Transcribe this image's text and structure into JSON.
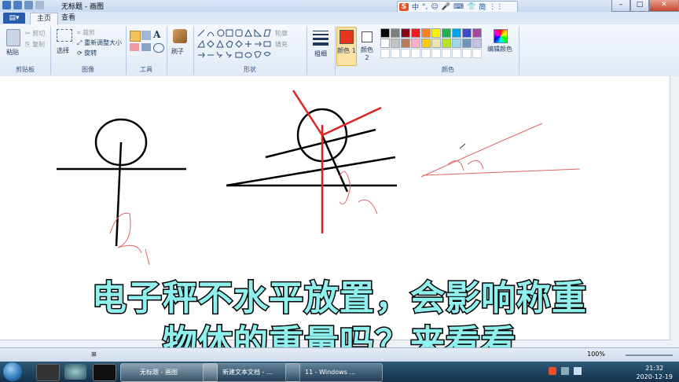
{
  "title_bar": {
    "title": "无标题 - 画图",
    "min": "–",
    "max": "□",
    "close": "✕"
  },
  "ime_bar": {
    "logo": "S",
    "items": [
      "中",
      "°,",
      "☺",
      "🎤",
      "⌨",
      "👕",
      "简",
      "⋮⋮"
    ]
  },
  "tabs": {
    "file": "▤▾",
    "home": "主页",
    "view": "查看"
  },
  "clipboard": {
    "paste": "粘贴",
    "cut": "剪切",
    "copy": "复制",
    "label": "剪贴板"
  },
  "image": {
    "select": "选择",
    "crop": "裁剪",
    "resize": "重新调整大小",
    "rotate": "旋转",
    "label": "图像"
  },
  "tools": {
    "label": "工具",
    "text_glyph": "A"
  },
  "brushes": {
    "label": "刷子"
  },
  "shapes": {
    "outline": "轮廓",
    "fill": "填充",
    "label": "形状"
  },
  "size": {
    "label": "粗细"
  },
  "color1": {
    "label": "颜色 1",
    "value": "#e8341c"
  },
  "color2": {
    "label": "颜色 2",
    "value": "#ffffff"
  },
  "colors": {
    "label": "颜色",
    "edit": "编辑颜色",
    "palette_row1": [
      "#000000",
      "#7f7f7f",
      "#880015",
      "#ed1c24",
      "#ff7f27",
      "#fff200",
      "#22b14c",
      "#00a2e8",
      "#3f48cc",
      "#a349a4"
    ],
    "palette_row2": [
      "#ffffff",
      "#c3c3c3",
      "#b97a57",
      "#ffaec9",
      "#ffc90e",
      "#efe4b0",
      "#b5e61d",
      "#99d9ea",
      "#7092be",
      "#c8bfe7"
    ]
  },
  "statusbar": {
    "zoom": "100%",
    "pos": "⊞"
  },
  "caption": {
    "line1": "电子秤不水平放置，会影响称重",
    "line2": "物体的重量吗？来看看"
  },
  "taskbar": {
    "tasks": [
      {
        "label": "无标题 - 画图"
      },
      {
        "label": "新建文本文档 - ..."
      },
      {
        "label": "11 - Windows ..."
      }
    ],
    "time": "21:32",
    "date": "2020-12-19"
  }
}
